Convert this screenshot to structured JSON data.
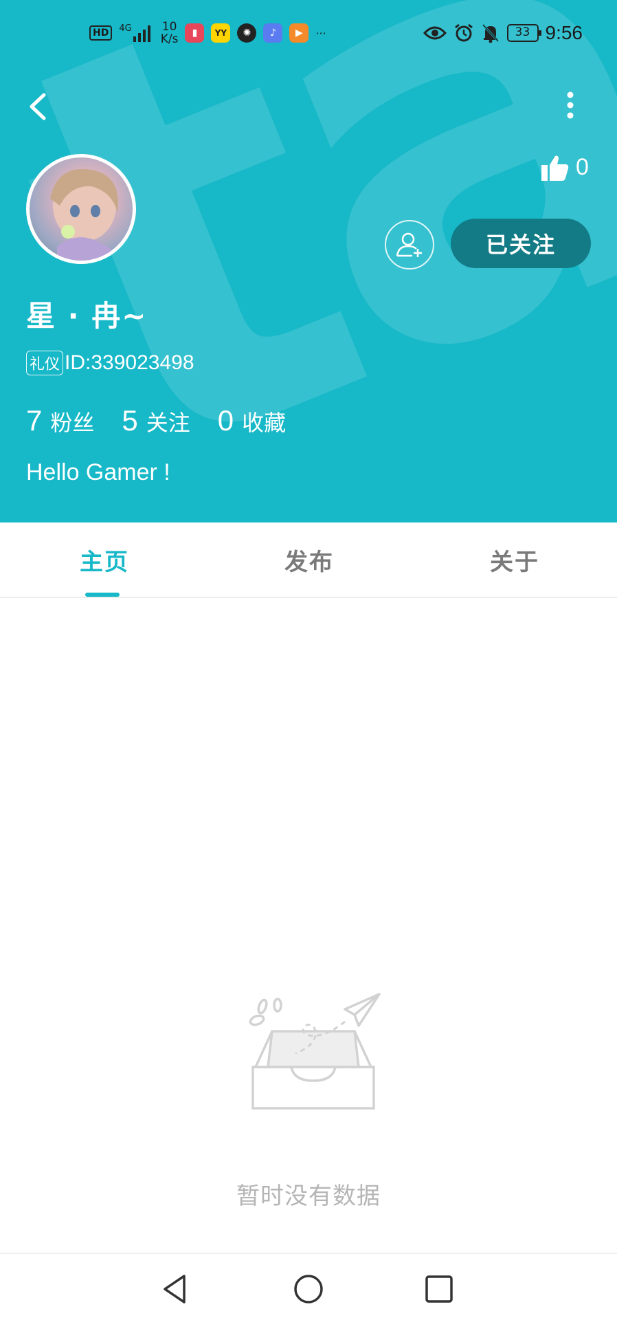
{
  "status_bar": {
    "network_badge": "HD",
    "signal_label": "4G",
    "speed_value": "10",
    "speed_unit": "K/s",
    "more_apps": "···",
    "battery": "33",
    "time": "9:56"
  },
  "header": {
    "background_color": "#17b8c8",
    "likes_count": "0",
    "follow_button_label": "已关注",
    "username": "星 · 冉~",
    "id_badge": "礼仪",
    "id_text": "ID:339023498",
    "stats": [
      {
        "value": "7",
        "label": "粉丝"
      },
      {
        "value": "5",
        "label": "关注"
      },
      {
        "value": "0",
        "label": "收藏"
      }
    ],
    "bio": "Hello Gamer !"
  },
  "tabs": {
    "items": [
      {
        "label": "主页",
        "active": true
      },
      {
        "label": "发布",
        "active": false
      },
      {
        "label": "关于",
        "active": false
      }
    ],
    "accent_color": "#17b8c8"
  },
  "empty_state": {
    "message": "暂时没有数据",
    "icon": "empty-inbox-paper-plane-icon"
  },
  "nav_bar": {
    "buttons": [
      "back-triangle-icon",
      "home-circle-icon",
      "recents-square-icon"
    ]
  }
}
